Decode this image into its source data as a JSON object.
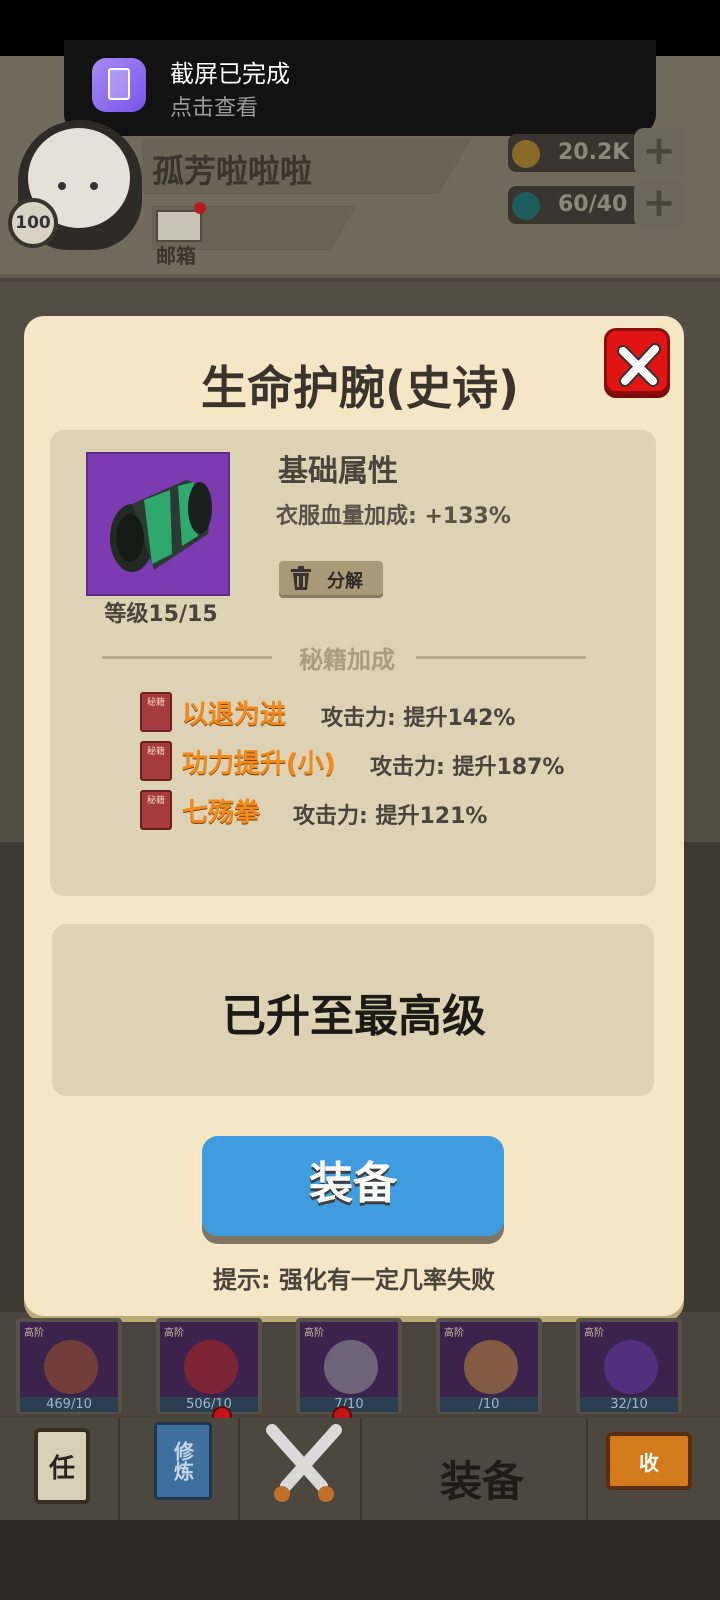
{
  "notification": {
    "title": "截屏已完成",
    "subtitle": "点击查看"
  },
  "player": {
    "name": "孤芳啦啦啦",
    "level": "100",
    "mailbox_label": "邮箱"
  },
  "resources": [
    {
      "icon": "coin-icon",
      "value": "20.2K",
      "color": "#c98a24"
    },
    {
      "icon": "gem-icon",
      "value": "60/40",
      "color": "#1c8a8c"
    }
  ],
  "dialog": {
    "title": "生命护腕(史诗)",
    "item_level": "等级15/15",
    "base_title": "基础属性",
    "base_attr": "衣服血量加成: +133%",
    "decompose_label": "分解",
    "section_label": "秘籍加成",
    "book_label": "秘籍",
    "skills": [
      {
        "name": "以退为进",
        "effect": "攻击力: 提升142%"
      },
      {
        "name": "功力提升(小)",
        "effect": "攻击力: 提升187%"
      },
      {
        "name": "七殇拳",
        "effect": "攻击力: 提升121%"
      }
    ],
    "max_text": "已升至最高级",
    "equip_label": "装备",
    "tip": "提示: 强化有一定几率失败"
  },
  "inventory": [
    {
      "tag": "高阶",
      "count": "469/10"
    },
    {
      "tag": "高阶",
      "count": "506/10"
    },
    {
      "tag": "高阶",
      "count": "7/10"
    },
    {
      "tag": "高阶",
      "count": "/10"
    },
    {
      "tag": "高阶",
      "count": "32/10"
    }
  ],
  "nav": {
    "task_label": "任",
    "train_label": "修炼",
    "equip_label": "装备",
    "collect_label": "收"
  }
}
